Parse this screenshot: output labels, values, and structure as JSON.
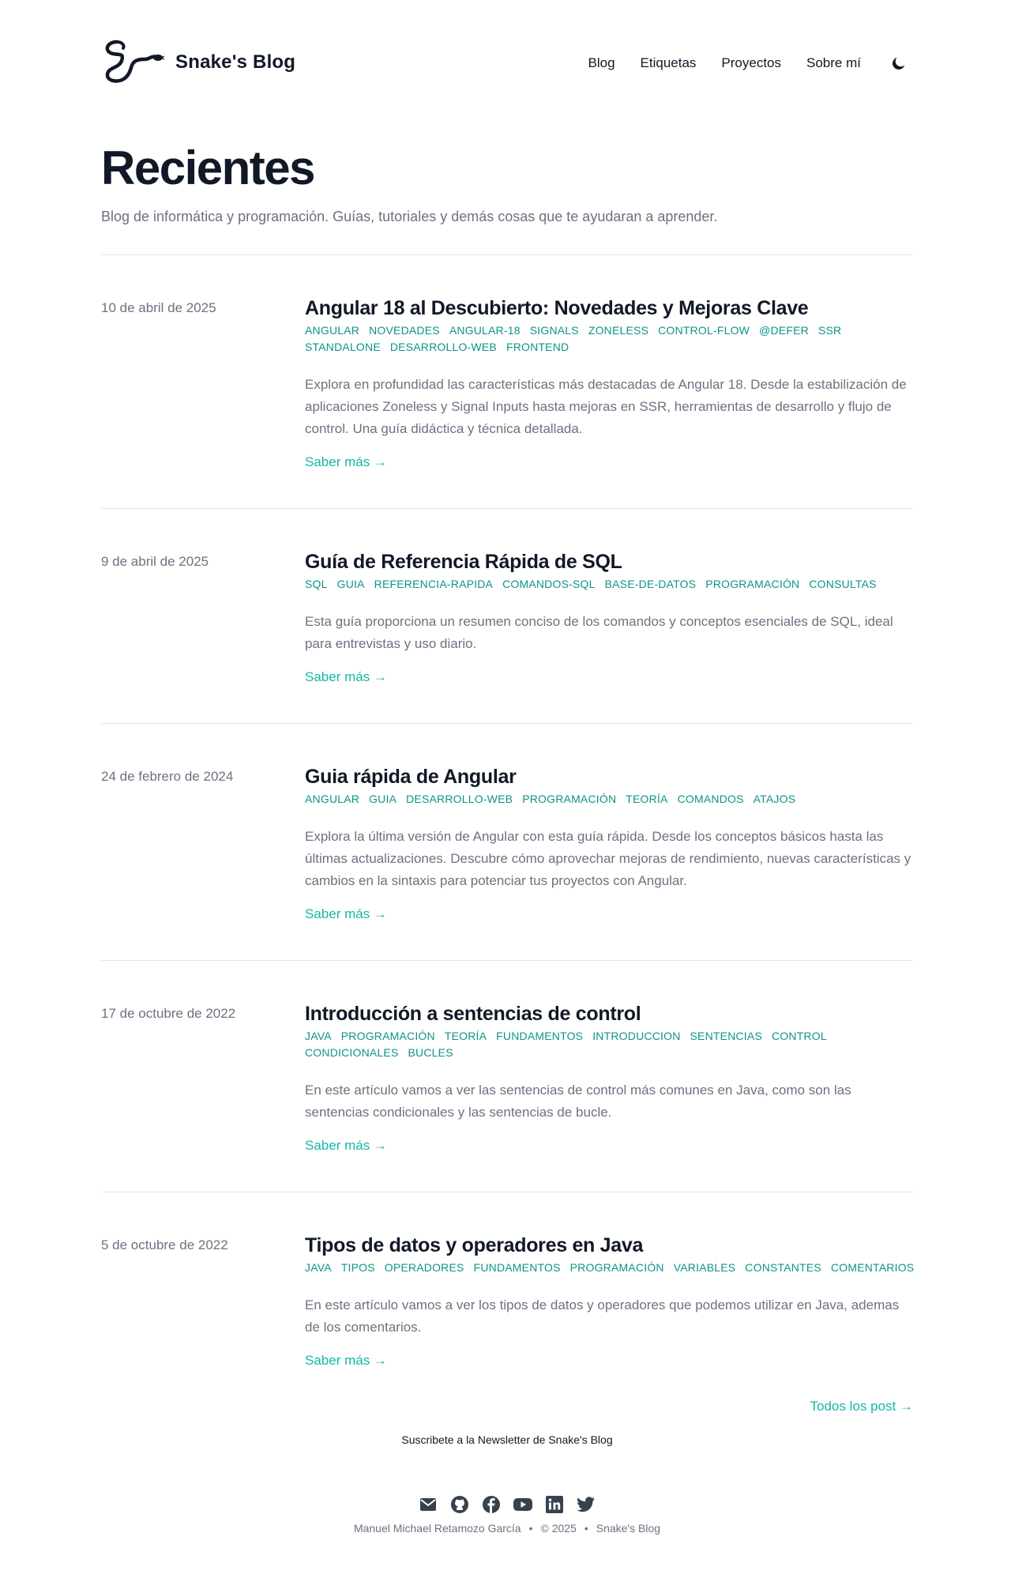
{
  "header": {
    "brand_name": "Snake's Blog",
    "nav": [
      {
        "label": "Blog"
      },
      {
        "label": "Etiquetas"
      },
      {
        "label": "Proyectos"
      },
      {
        "label": "Sobre mí"
      }
    ],
    "theme_icon": "moon-icon"
  },
  "hero": {
    "title": "Recientes",
    "subtitle": "Blog de informática y programación. Guías, tutoriales y demás cosas que te ayudaran a aprender."
  },
  "posts": [
    {
      "date": "10 de abril de 2025",
      "title": "Angular 18 al Descubierto: Novedades y Mejoras Clave",
      "tags": [
        "ANGULAR",
        "NOVEDADES",
        "ANGULAR-18",
        "SIGNALS",
        "ZONELESS",
        "CONTROL-FLOW",
        "@DEFER",
        "SSR",
        "STANDALONE",
        "DESARROLLO-WEB",
        "FRONTEND"
      ],
      "summary": "Explora en profundidad las características más destacadas de Angular 18. Desde la estabilización de aplicaciones Zoneless y Signal Inputs hasta mejoras en SSR, herramientas de desarrollo y flujo de control. Una guía didáctica y técnica detallada.",
      "more": "Saber más →"
    },
    {
      "date": "9 de abril de 2025",
      "title": "Guía de Referencia Rápida de SQL",
      "tags": [
        "SQL",
        "GUIA",
        "REFERENCIA-RAPIDA",
        "COMANDOS-SQL",
        "BASE-DE-DATOS",
        "PROGRAMACIÓN",
        "CONSULTAS"
      ],
      "summary": "Esta guía proporciona un resumen conciso de los comandos y conceptos esenciales de SQL, ideal para entrevistas y uso diario.",
      "more": "Saber más →"
    },
    {
      "date": "24 de febrero de 2024",
      "title": "Guia rápida de Angular",
      "tags": [
        "ANGULAR",
        "GUIA",
        "DESARROLLO-WEB",
        "PROGRAMACIÓN",
        "TEORÍA",
        "COMANDOS",
        "ATAJOS"
      ],
      "summary": "Explora la última versión de Angular con esta guía rápida. Desde los conceptos básicos hasta las últimas actualizaciones. Descubre cómo aprovechar mejoras de rendimiento, nuevas características y cambios en la sintaxis para potenciar tus proyectos con Angular.",
      "more": "Saber más →"
    },
    {
      "date": "17 de octubre de 2022",
      "title": "Introducción a sentencias de control",
      "tags": [
        "JAVA",
        "PROGRAMACIÓN",
        "TEORÍA",
        "FUNDAMENTOS",
        "INTRODUCCION",
        "SENTENCIAS",
        "CONTROL",
        "CONDICIONALES",
        "BUCLES"
      ],
      "summary": "En este artículo vamos a ver las sentencias de control más comunes en Java, como son las sentencias condicionales y las sentencias de bucle.",
      "more": "Saber más →"
    },
    {
      "date": "5 de octubre de 2022",
      "title": "Tipos de datos y operadores en Java",
      "tags": [
        "JAVA",
        "TIPOS",
        "OPERADORES",
        "FUNDAMENTOS",
        "PROGRAMACIÓN",
        "VARIABLES",
        "CONSTANTES",
        "COMENTARIOS"
      ],
      "summary": "En este artículo vamos a ver los tipos de datos y operadores que podemos utilizar en Java, ademas de los comentarios.",
      "more": "Saber más →"
    }
  ],
  "all_posts": "Todos los post →",
  "newsletter": "Suscribete a la Newsletter de Snake's Blog",
  "footer": {
    "socials": [
      "mail-icon",
      "github-icon",
      "facebook-icon",
      "youtube-icon",
      "linkedin-icon",
      "twitter-icon"
    ],
    "author": "Manuel Michael Retamozo García",
    "sep": "•",
    "year": "© 2025",
    "site": "Snake's Blog"
  },
  "colors": {
    "accent": "#14b8a6",
    "tag": "#0d9488",
    "text": "#111827",
    "muted": "#6b7280",
    "border": "#e5e7eb"
  }
}
